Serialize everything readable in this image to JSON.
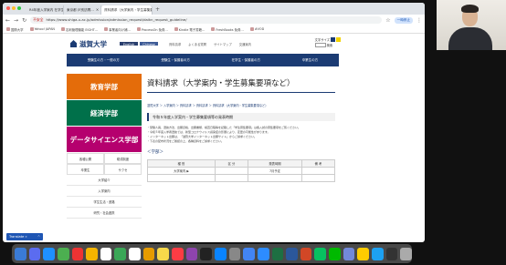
{
  "browser": {
    "tabs": [
      {
        "label": "R4年度入学案内 在学生…"
      },
      {
        "label": "東京都 戸別訪問…"
      },
      {
        "label": "資料請求（大学案内・学生募集要項…",
        "active": true
      }
    ],
    "new_tab": "+",
    "url_warning": "不安全",
    "url": "https://www.shiga-u.ac.jp/admission/admission_request/daikn_request_guideline/",
    "profile_badge": "一時停止",
    "bookmarks": [
      "国際大学",
      "Yahoo! JAPAN",
      "名刺管理機能 EIGHT…",
      "事業者向け補…",
      "ProcessOn 免費…",
      "Kindle 電子書籍…",
      "FreshBooks 免費…",
      "#VOD"
    ]
  },
  "site": {
    "logo": "滋賀大学",
    "lang": [
      "English",
      "Chinese"
    ],
    "util_links": [
      "資料請求",
      "よくある質問",
      "サイトマップ",
      "交通案内"
    ],
    "search_label": "文字サイズ",
    "search_sub": "検索",
    "gnav": [
      "受験生の方・一般の方",
      "受験生・保護者の方",
      "在学生・保護者の方",
      "卒業生の方"
    ],
    "side": {
      "faculties": [
        "教育学部",
        "経済学部",
        "データサイエンス学部"
      ],
      "grid": [
        "各種公開",
        "助成制度",
        "卒業生",
        "サクセ"
      ],
      "list": [
        "大学紹介",
        "入学案内",
        "学生生活・進路",
        "研究・社会連携"
      ]
    },
    "main": {
      "title": "資料請求（大学案内・学生募集要項など）",
      "breadcrumb": "滋賀大学 ＞ 入学案内 ＞ 資料請求 ＞ 資料請求 ＞ 資料請求（大学案内・学生募集要項など）",
      "notice": "令和５年度入学案内・学生募集要項等の発表時期",
      "bullets": [
        "・受験人員、選抜方法、出願資格、出願書類、検査日程等を記載した「学生募集要項」は各入試の募集要項をご覧ください。",
        "・令和５年度入学者選抜では、新型コロナウイルス感染症の影響により、変更の可能性があります。",
        "・インターネット出願は、「滋賀大学インターネット出願サイト」からご請求ください。",
        "・下表の配布状況をご確認の上、各種資料をご請求ください。"
      ],
      "section": "＜学部＞",
      "table_headers": [
        "種 別",
        "区 分",
        "発表時期",
        "備 考"
      ],
      "table_rows": [
        [
          "大学案内 ▶",
          "",
          "7月予定",
          ""
        ],
        [
          "",
          "",
          "",
          ""
        ]
      ]
    },
    "translate": "Translate »"
  },
  "colors": {
    "navy": "#1b3b73",
    "orange": "#e46c0a",
    "green": "#00704a",
    "magenta": "#b5006e"
  }
}
